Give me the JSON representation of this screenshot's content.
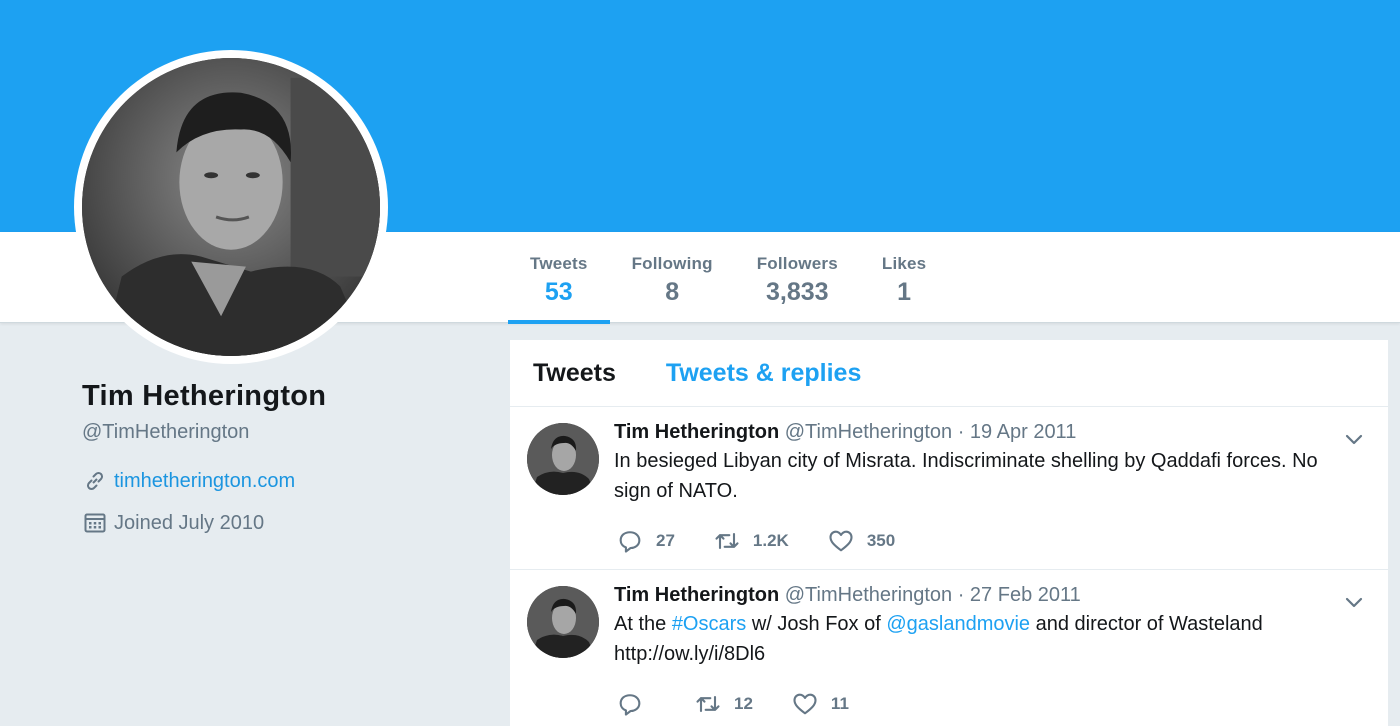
{
  "profile": {
    "name": "Tim Hetherington",
    "handle": "@TimHetherington",
    "website": "timhetherington.com",
    "joined": "Joined July 2010"
  },
  "stats": [
    {
      "label": "Tweets",
      "value": "53",
      "active": true
    },
    {
      "label": "Following",
      "value": "8",
      "active": false
    },
    {
      "label": "Followers",
      "value": "3,833",
      "active": false
    },
    {
      "label": "Likes",
      "value": "1",
      "active": false
    }
  ],
  "tabs": {
    "tweets": "Tweets",
    "tweets_replies": "Tweets & replies"
  },
  "tweets": [
    {
      "name": "Tim Hetherington",
      "handle": "@TimHetherington",
      "date": "· 19 Apr 2011",
      "text_parts": [
        "In besieged Libyan city of Misrata. Indiscriminate shelling by Qaddafi forces. No sign of NATO."
      ],
      "replies": "27",
      "retweets": "1.2K",
      "likes": "350"
    },
    {
      "name": "Tim Hetherington",
      "handle": "@TimHetherington",
      "date": "· 27 Feb 2011",
      "text_parts": [
        "At the ",
        "#Oscars",
        " w/ Josh Fox of ",
        "@gaslandmovie",
        " and director of Wasteland http://ow.ly/i/8Dl6"
      ],
      "replies": "",
      "retweets": "12",
      "likes": "11"
    }
  ],
  "icons": {
    "link": "link-icon",
    "calendar": "calendar-icon",
    "reply": "reply-icon",
    "retweet": "retweet-icon",
    "like": "heart-icon",
    "caret": "chevron-down-icon"
  },
  "colors": {
    "accent": "#1da1f2",
    "banner": "#1da1f2",
    "background": "#e6ecf0",
    "muted": "#657786"
  }
}
